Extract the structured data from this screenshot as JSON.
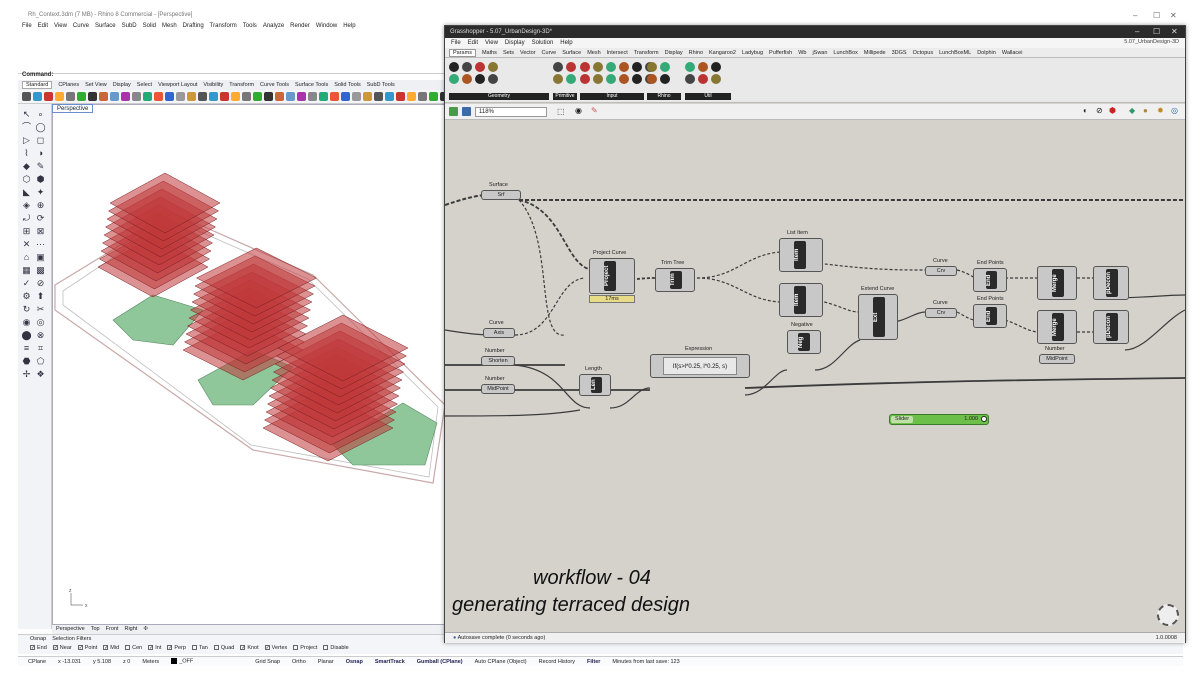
{
  "rhino": {
    "title": "Rh_Context.3dm (7 MB) - Rhino 8 Commercial - [Perspective]",
    "menu": [
      "File",
      "Edit",
      "View",
      "Curve",
      "Surface",
      "SubD",
      "Solid",
      "Mesh",
      "Drafting",
      "Transform",
      "Tools",
      "Analyze",
      "Render",
      "Window",
      "Help"
    ],
    "command_label": "Command:",
    "tabs": [
      "Standard",
      "CPlanes",
      "Set View",
      "Display",
      "Select",
      "Viewport Layout",
      "Visibility",
      "Transform",
      "Curve Tools",
      "Surface Tools",
      "Solid Tools",
      "SubD Tools"
    ],
    "viewport_label": "Perspective",
    "viewport_tabs": [
      "Perspective",
      "Top",
      "Front",
      "Right"
    ],
    "osnap_tabs": [
      "Osnap",
      "Selection Filters"
    ],
    "osnaps": [
      {
        "label": "End",
        "on": true
      },
      {
        "label": "Near",
        "on": true
      },
      {
        "label": "Point",
        "on": true
      },
      {
        "label": "Mid",
        "on": true
      },
      {
        "label": "Cen",
        "on": false
      },
      {
        "label": "Int",
        "on": true
      },
      {
        "label": "Perp",
        "on": true
      },
      {
        "label": "Tan",
        "on": false
      },
      {
        "label": "Quad",
        "on": false
      },
      {
        "label": "Knot",
        "on": true
      },
      {
        "label": "Vertex",
        "on": true
      },
      {
        "label": "Project",
        "on": false
      },
      {
        "label": "Disable",
        "on": false
      }
    ],
    "status": {
      "cplane": "CPlane",
      "x": "x -13.031",
      "y": "y 5.108",
      "z": "z 0",
      "units": "Meters",
      "layer": "_OFF",
      "grid_snap": "Grid Snap",
      "ortho": "Ortho",
      "planar": "Planar",
      "osnap": "Osnap",
      "smarttrack": "SmartTrack",
      "gumball": "Gumball (CPlane)",
      "auto_cplane": "Auto CPlane (Object)",
      "record": "Record History",
      "filter": "Filter",
      "minutes": "Minutes from last save: 123"
    }
  },
  "gh": {
    "title": "Grasshopper - 5.07_UrbanDesign-3D*",
    "file": "5.07_UrbanDesign-3D",
    "menu": [
      "File",
      "Edit",
      "View",
      "Display",
      "Solution",
      "Help"
    ],
    "tabs": [
      "Params",
      "Maths",
      "Sets",
      "Vector",
      "Curve",
      "Surface",
      "Mesh",
      "Intersect",
      "Transform",
      "Display",
      "Rhino",
      "Kangaroo2",
      "Ladybug",
      "Pufferfish",
      "Wb",
      "jSwan",
      "LunchBox",
      "Millipede",
      "3DGS",
      "Octopus",
      "LunchBoxML",
      "Dolphin",
      "Wallacei"
    ],
    "ribbon_groups": [
      "Geometry",
      "Primitive",
      "Input",
      "Rhino",
      "Util"
    ],
    "zoom": "118%",
    "components": {
      "surface_label": "Surface",
      "srf": "Srf",
      "project_curve_label": "Project Curve",
      "project": "Project",
      "timer": "17ms",
      "trim_tree_label": "Trim Tree",
      "trim": "Trim",
      "list_item_label": "List Item",
      "item": "Item",
      "extend_curve_label": "Extend Curve",
      "ext": "Ext",
      "negative_label": "Negative",
      "neg": "Neg",
      "curve_label": "Curve",
      "crv": "Crv",
      "end_points_label": "End Points",
      "end": "End",
      "merge": "Merge",
      "pdecon": "pDecon",
      "number_label": "Number",
      "shorten": "Shorten",
      "midpoint": "MidPoint",
      "axis": "Axis",
      "length_label": "Length",
      "len": "Len",
      "expression_label": "Expression",
      "expression": "If(s>l*0.25, l*0.25, s)",
      "slider_label": "Slider",
      "slider_value": "1.000"
    },
    "status": "Autosave complete (0 seconds ago)",
    "version": "1.0.0008"
  },
  "overlay": {
    "title": "workflow - 04",
    "subtitle": "generating terraced design"
  },
  "colors": {
    "terrace": "#c0393b",
    "green": "#8fc79a",
    "slider": "#6cc04a"
  }
}
